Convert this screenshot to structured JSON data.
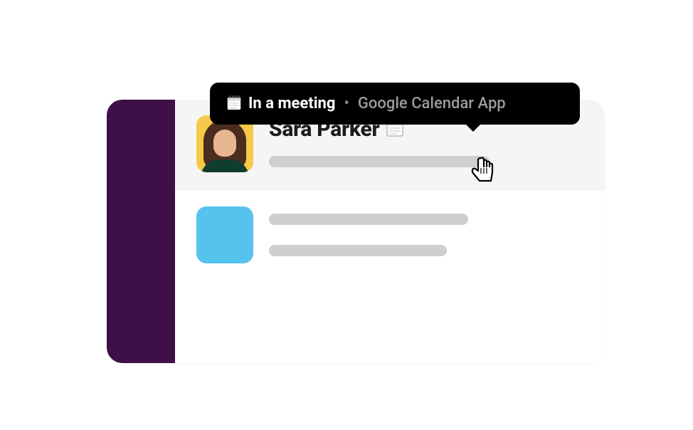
{
  "tooltip": {
    "status_text": "In a meeting",
    "separator": "•",
    "source_text": "Google Calendar App",
    "emoji_name": "spiral-calendar-icon"
  },
  "messages": [
    {
      "username": "Sara Parker",
      "status_emoji_name": "spiral-calendar-icon",
      "highlighted": true,
      "avatar_type": "person"
    },
    {
      "username": "",
      "status_emoji_name": "",
      "highlighted": false,
      "avatar_type": "placeholder"
    }
  ],
  "colors": {
    "sidebar_bg": "#3f1048",
    "avatar_placeholder": "#56c3ef",
    "avatar_person_bg": "#f7c948",
    "placeholder_line": "#cfcfcf",
    "tooltip_bg": "#000000"
  }
}
